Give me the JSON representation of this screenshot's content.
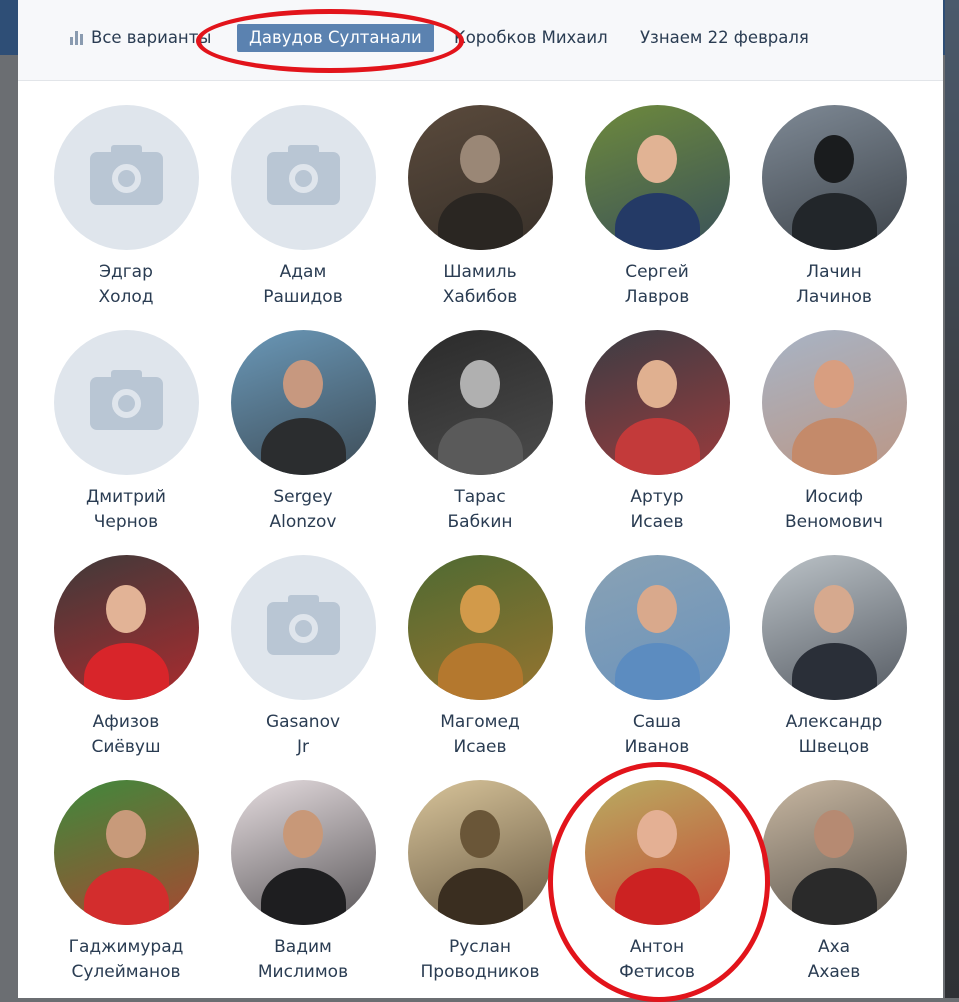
{
  "tabs": {
    "all": "Все варианты",
    "active": "Давудов Султанали",
    "korobkov": "Коробков Михаил",
    "date": "Узнаем 22 февраля"
  },
  "people": [
    {
      "first": "Эдгар",
      "last": "Холод",
      "photo": "placeholder"
    },
    {
      "first": "Адам",
      "last": "Рашидов",
      "photo": "placeholder"
    },
    {
      "first": "Шамиль",
      "last": "Хабибов",
      "photo": "gun",
      "bg": "#5a4a3c",
      "fg": "#2a2622",
      "skin": "#9a8776"
    },
    {
      "first": "Сергей",
      "last": "Лавров",
      "photo": "suit",
      "bg": "#6e8a3c",
      "fg": "#243a66",
      "skin": "#e1b394"
    },
    {
      "first": "Лачин",
      "last": "Лачинов",
      "photo": "bird",
      "bg": "#7f8a96",
      "fg": "#22262a",
      "skin": "#1a1c1e"
    },
    {
      "first": "Дмитрий",
      "last": "Чернов",
      "photo": "placeholder"
    },
    {
      "first": "Sergey",
      "last": "Alonzov",
      "photo": "crowd",
      "bg": "#6a98b8",
      "fg": "#2b2d2f",
      "skin": "#c7987f"
    },
    {
      "first": "Тарас",
      "last": "Бабкин",
      "photo": "bw",
      "bg": "#2a2a2a",
      "fg": "#5a5a5a",
      "skin": "#b0b0b0"
    },
    {
      "first": "Артур",
      "last": "Исаев",
      "photo": "pair",
      "bg": "#3a3d44",
      "fg": "#c33a3a",
      "skin": "#e0b090"
    },
    {
      "first": "Иосиф",
      "last": "Веномович",
      "photo": "face",
      "bg": "#a7b4c6",
      "fg": "#c48a6a",
      "skin": "#d89e80"
    },
    {
      "first": "Афизов",
      "last": "Сиёвуш",
      "photo": "red",
      "bg": "#3e3a3a",
      "fg": "#d8252a",
      "skin": "#e2b396"
    },
    {
      "first": "Gasanov",
      "last": "Jr",
      "photo": "placeholder"
    },
    {
      "first": "Магомед",
      "last": "Исаев",
      "photo": "lions",
      "bg": "#4e6a32",
      "fg": "#b4782e",
      "skin": "#d29a4a"
    },
    {
      "first": "Саша",
      "last": "Иванов",
      "photo": "street",
      "bg": "#8aa2b4",
      "fg": "#5c8cc0",
      "skin": "#d9a98c"
    },
    {
      "first": "Александр",
      "last": "Швецов",
      "photo": "building",
      "bg": "#bcc3c8",
      "fg": "#2a2f38",
      "skin": "#d6a98e"
    },
    {
      "first": "Гаджимурад",
      "last": "Сулейманов",
      "photo": "football",
      "bg": "#3e8a3c",
      "fg": "#d32d2d",
      "skin": "#c89a7a"
    },
    {
      "first": "Вадим",
      "last": "Мислимов",
      "photo": "snow",
      "bg": "#e6dde0",
      "fg": "#1e1e20",
      "skin": "#c89878"
    },
    {
      "first": "Руслан",
      "last": "Проводников",
      "photo": "art",
      "bg": "#d8c49a",
      "fg": "#3a2e20",
      "skin": "#6a5638"
    },
    {
      "first": "Антон",
      "last": "Фетисов",
      "photo": "baby",
      "bg": "#b8ad62",
      "fg": "#cc2222",
      "skin": "#e4b094"
    },
    {
      "first": "Аха",
      "last": "Ахаев",
      "photo": "sofa",
      "bg": "#c9b8a2",
      "fg": "#2a2a2a",
      "skin": "#b68a72"
    }
  ],
  "colors": {
    "active_tab_bg": "#5b82b0",
    "name_text": "#2a3c52",
    "highlight": "#e2141b"
  }
}
